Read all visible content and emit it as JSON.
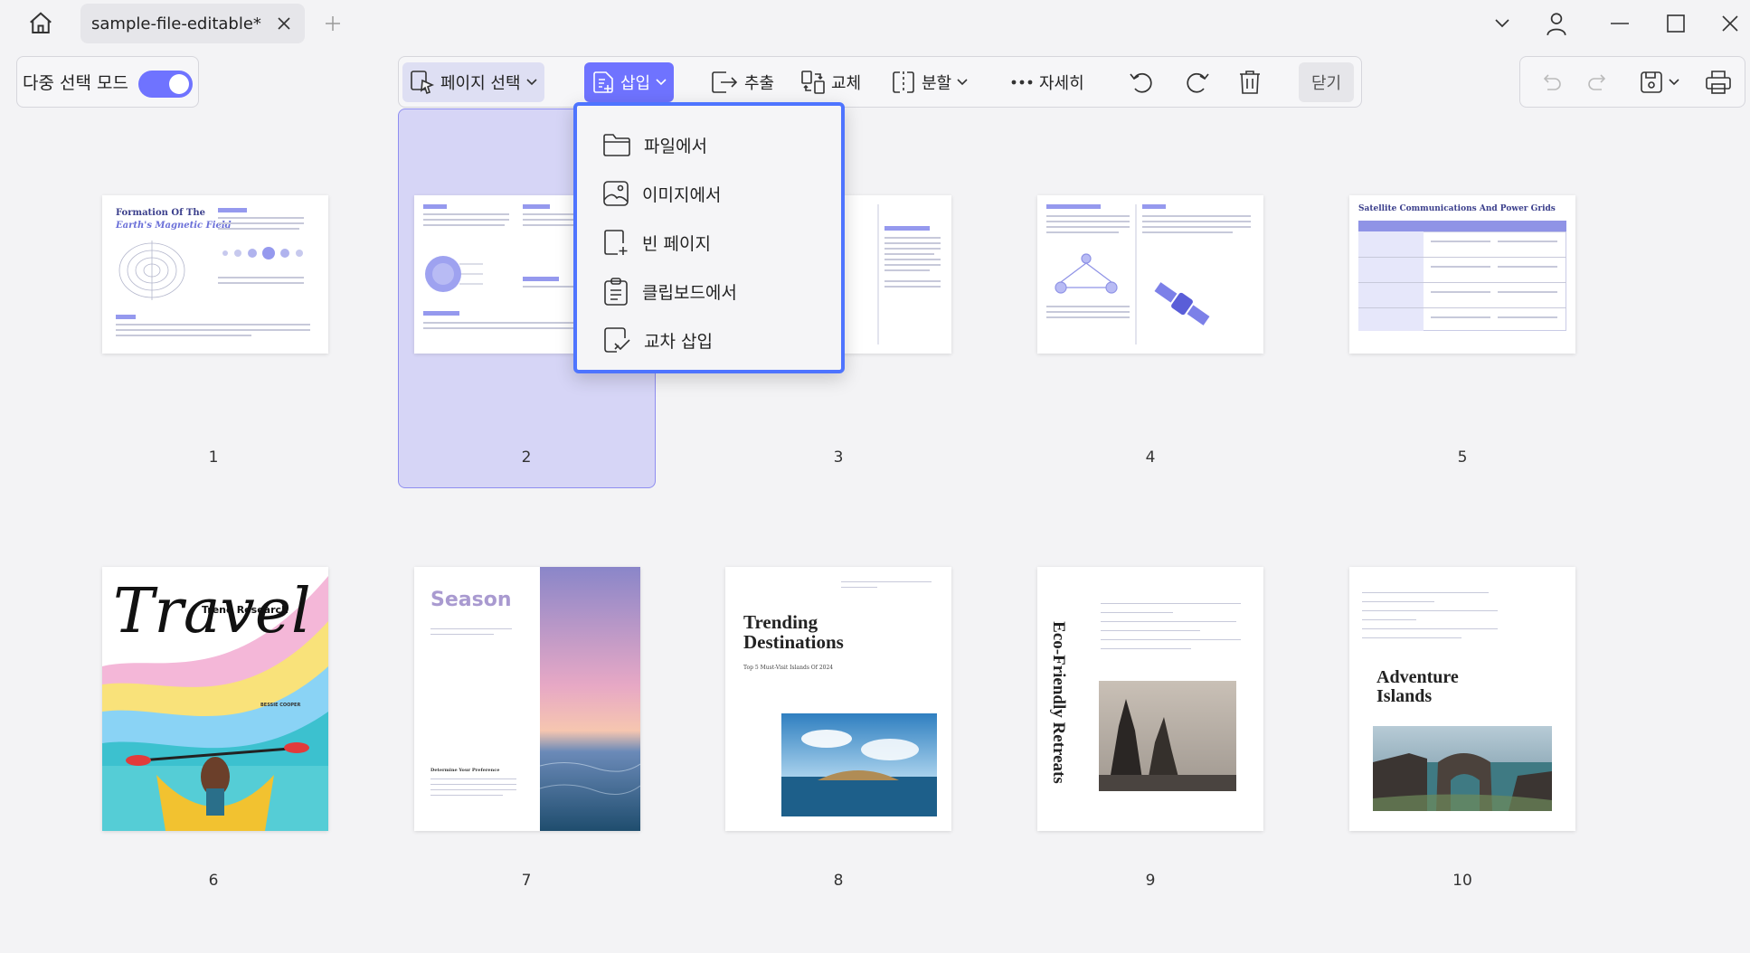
{
  "tab": {
    "title": "sample-file-editable*"
  },
  "multi_select": {
    "label": "다중 선택 모드"
  },
  "toolbar": {
    "page_select": "페이지 선택",
    "insert": "삽입",
    "extract": "추출",
    "replace": "교체",
    "split": "분할",
    "more": "자세히",
    "close": "닫기"
  },
  "insert_menu": {
    "items": [
      {
        "label": "파일에서",
        "icon": "folder-icon"
      },
      {
        "label": "이미지에서",
        "icon": "image-icon"
      },
      {
        "label": "빈 페이지",
        "icon": "blank-page-icon"
      },
      {
        "label": "클립보드에서",
        "icon": "clipboard-icon"
      },
      {
        "label": "교차 삽입",
        "icon": "interleave-icon"
      }
    ]
  },
  "pages": [
    {
      "number": "1",
      "heading": "Formation Of The",
      "subheading": "Earth's Magnetic Field"
    },
    {
      "number": "2"
    },
    {
      "number": "3"
    },
    {
      "number": "4"
    },
    {
      "number": "5",
      "heading": "Satellite Communications And Power Grids"
    },
    {
      "number": "6",
      "title": "Travel",
      "subtitle": "Trend Research",
      "author": "BESSIE COOPER"
    },
    {
      "number": "7",
      "title": "Season",
      "caption": "Determine Your Preference"
    },
    {
      "number": "8",
      "title": "Trending Destinations",
      "subtitle": "Top 5 Must-Visit Islands Of 2024"
    },
    {
      "number": "9",
      "title": "Eco-Friendly Retreats"
    },
    {
      "number": "10",
      "title": "Adventure Islands"
    }
  ],
  "colors": {
    "accent": "#6f73ff",
    "selection": "#d6d5f6",
    "menu_border": "#4e74ff"
  }
}
